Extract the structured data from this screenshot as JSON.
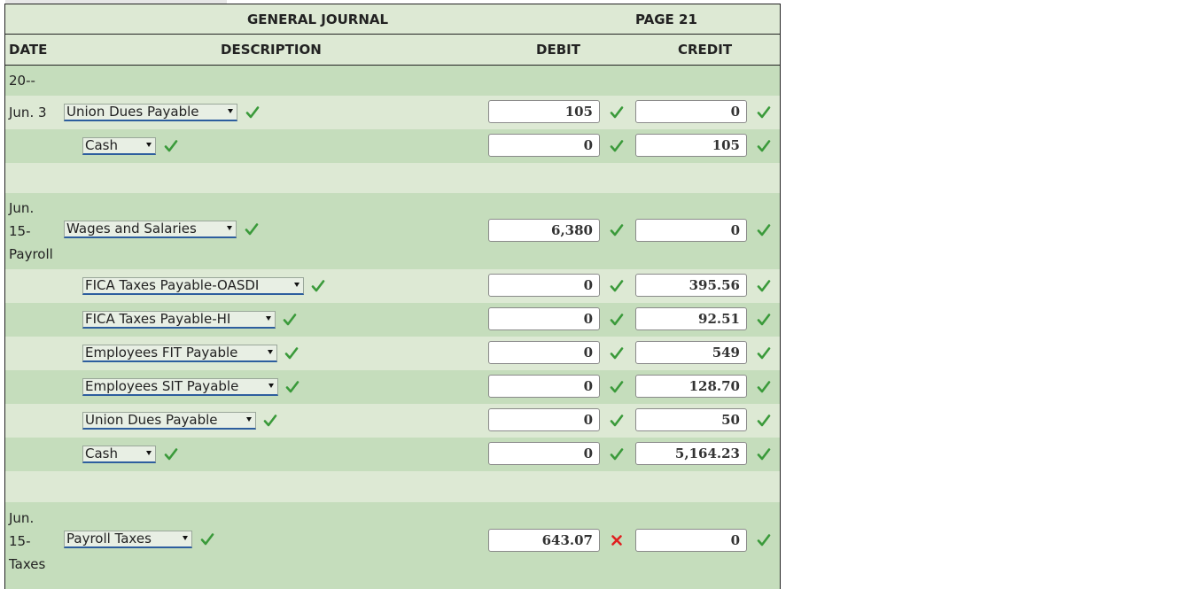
{
  "header": {
    "title": "GENERAL JOURNAL",
    "page": "PAGE 21",
    "col_date": "DATE",
    "col_description": "DESCRIPTION",
    "col_debit": "DEBIT",
    "col_credit": "CREDIT"
  },
  "year": "20--",
  "entries": [
    {
      "date_lines": [
        "Jun. 3"
      ],
      "lines": [
        {
          "account": "Union Dues Payable",
          "debit": "105",
          "credit": "0",
          "debit_mark": "check",
          "credit_mark": "check"
        },
        {
          "account": "Cash",
          "debit": "0",
          "credit": "105",
          "debit_mark": "check",
          "credit_mark": "check"
        }
      ]
    },
    {
      "date_lines": [
        "Jun.",
        "15-",
        "Payroll"
      ],
      "lines": [
        {
          "account": "Wages and Salaries",
          "debit": "6,380",
          "credit": "0",
          "debit_mark": "check",
          "credit_mark": "check"
        },
        {
          "account": "FICA Taxes Payable-OASDI",
          "debit": "0",
          "credit": "395.56",
          "debit_mark": "check",
          "credit_mark": "check"
        },
        {
          "account": "FICA Taxes Payable-HI",
          "debit": "0",
          "credit": "92.51",
          "debit_mark": "check",
          "credit_mark": "check"
        },
        {
          "account": "Employees FIT Payable",
          "debit": "0",
          "credit": "549",
          "debit_mark": "check",
          "credit_mark": "check"
        },
        {
          "account": "Employees SIT Payable",
          "debit": "0",
          "credit": "128.70",
          "debit_mark": "check",
          "credit_mark": "check"
        },
        {
          "account": "Union Dues Payable",
          "debit": "0",
          "credit": "50",
          "debit_mark": "check",
          "credit_mark": "check"
        },
        {
          "account": "Cash",
          "debit": "0",
          "credit": "5,164.23",
          "debit_mark": "check",
          "credit_mark": "check"
        }
      ]
    },
    {
      "date_lines": [
        "Jun.",
        "15-",
        "Taxes"
      ],
      "lines": [
        {
          "account": "Payroll Taxes",
          "debit": "643.07",
          "credit": "0",
          "debit_mark": "cross",
          "credit_mark": "check"
        }
      ]
    }
  ],
  "colors": {
    "check": "#3a9a3a",
    "cross": "#e02020",
    "row_light": "#dde9d4",
    "row_dark": "#c5ddbc"
  }
}
